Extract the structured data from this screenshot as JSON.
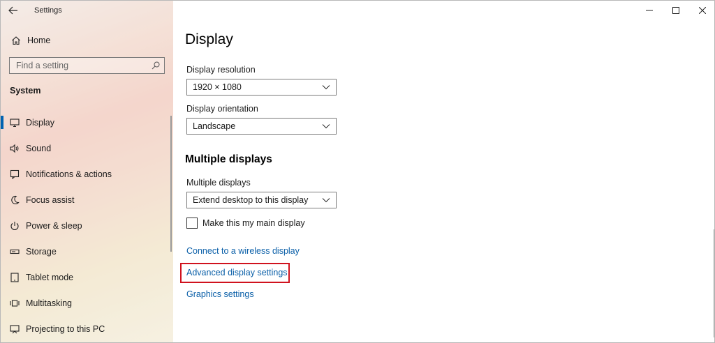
{
  "window": {
    "app_title": "Settings",
    "back_icon": "back-arrow-icon",
    "controls": [
      "minimize-icon",
      "maximize-icon",
      "close-icon"
    ]
  },
  "sidebar": {
    "home_label": "Home",
    "search_placeholder": "Find a setting",
    "section_title": "System",
    "items": [
      {
        "label": "Display",
        "icon": "monitor-icon",
        "selected": true
      },
      {
        "label": "Sound",
        "icon": "speaker-icon",
        "selected": false
      },
      {
        "label": "Notifications & actions",
        "icon": "notification-icon",
        "selected": false
      },
      {
        "label": "Focus assist",
        "icon": "moon-icon",
        "selected": false
      },
      {
        "label": "Power & sleep",
        "icon": "power-icon",
        "selected": false
      },
      {
        "label": "Storage",
        "icon": "storage-icon",
        "selected": false
      },
      {
        "label": "Tablet mode",
        "icon": "tablet-icon",
        "selected": false
      },
      {
        "label": "Multitasking",
        "icon": "multitasking-icon",
        "selected": false
      },
      {
        "label": "Projecting to this PC",
        "icon": "projecting-icon",
        "selected": false
      }
    ]
  },
  "main": {
    "title": "Display",
    "resolution": {
      "label": "Display resolution",
      "value": "1920 × 1080"
    },
    "orientation": {
      "label": "Display orientation",
      "value": "Landscape"
    },
    "multiple_heading": "Multiple displays",
    "multiple": {
      "label": "Multiple displays",
      "value": "Extend desktop to this display"
    },
    "main_display_checkbox": {
      "label": "Make this my main display",
      "checked": false
    },
    "links": {
      "wireless": "Connect to a wireless display",
      "advanced": "Advanced display settings",
      "graphics": "Graphics settings"
    }
  },
  "colors": {
    "accent": "#0063b1",
    "link": "#0a5fa8",
    "highlight": "#d0121e"
  }
}
